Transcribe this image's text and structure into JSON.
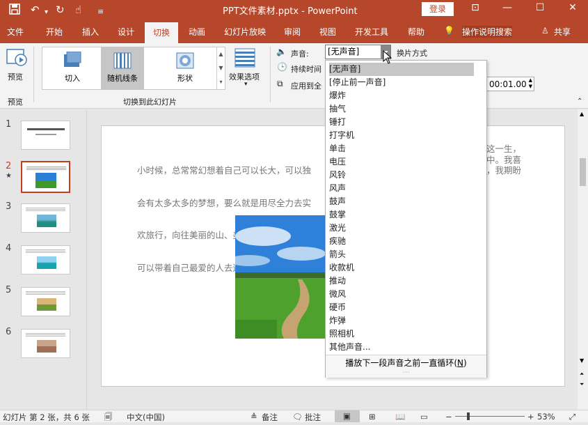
{
  "titlebar": {
    "title": "PPT文件素材.pptx - PowerPoint",
    "login": "登录",
    "save_icon": "save-icon",
    "undo_icon": "undo-icon",
    "redo_icon": "redo-icon",
    "touch_icon": "touch-icon",
    "more_icon": "more-icon"
  },
  "menu": {
    "items": [
      "文件",
      "开始",
      "插入",
      "设计",
      "切换",
      "动画",
      "幻灯片放映",
      "审阅",
      "视图",
      "开发工具",
      "帮助"
    ],
    "tell_me": "操作说明搜索",
    "share": "共享"
  },
  "ribbon": {
    "preview_label": "预览",
    "preview_group": "预览",
    "gallery": [
      "切入",
      "随机线条",
      "形状"
    ],
    "effect_options": "效果选项",
    "group_label": "切换到此幻灯片",
    "sound_label": "声音:",
    "sound_value": "[无声音]",
    "switch_mode": "换片方式",
    "duration_label": "持续时间",
    "apply_all": "应用到全",
    "time_value": "00:01.00"
  },
  "dropdown": {
    "items": [
      "[无声音]",
      "[停止前一声音]",
      "爆炸",
      "抽气",
      "锤打",
      "打字机",
      "单击",
      "电压",
      "风铃",
      "风声",
      "鼓声",
      "鼓掌",
      "激光",
      "疾驰",
      "箭头",
      "收款机",
      "推动",
      "微风",
      "硬币",
      "炸弹",
      "照相机",
      "其他声音..."
    ],
    "loop_option": "播放下一段声音之前一直循环(",
    "loop_key": "N",
    "loop_close": ")"
  },
  "slides": {
    "numbers": [
      "1",
      "2",
      "3",
      "4",
      "5",
      "6"
    ],
    "star": "★"
  },
  "slide": {
    "text_lines": [
      "小时候，总常常幻想着自己可以长大，可以独",
      "会有太多太多的梦想，要么就是用尽全力去实",
      "欢旅行，向往美丽的山、美丽的水，一见到大",
      "可以带着自己最爱的人去遨游世界，让他给自"
    ],
    "text_tail": [
      "这一生，",
      "中。我喜",
      "，我期盼",
      ""
    ]
  },
  "status": {
    "slide_info": "幻灯片 第 2 张，共 6 张",
    "language": "中文(中国)",
    "notes": "备注",
    "comments": "批注",
    "zoom": "53%"
  }
}
